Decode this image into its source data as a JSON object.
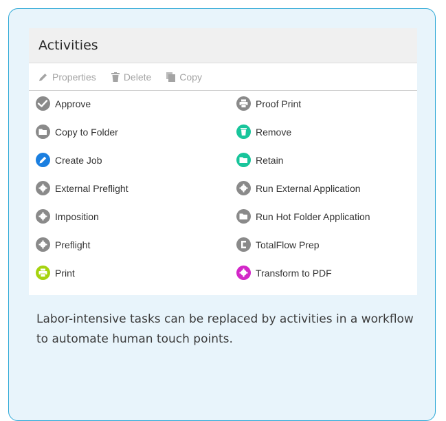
{
  "panel": {
    "title": "Activities",
    "toolbar": {
      "properties": "Properties",
      "delete": "Delete",
      "copy": "Copy"
    }
  },
  "activities": [
    {
      "label": "Approve",
      "icon": "check-icon",
      "color": "#8a8a8a"
    },
    {
      "label": "Copy to Folder",
      "icon": "folder-icon",
      "color": "#8a8a8a"
    },
    {
      "label": "Create Job",
      "icon": "pencil-icon",
      "color": "#1b7fe0"
    },
    {
      "label": "External Preflight",
      "icon": "gear-icon",
      "color": "#8a8a8a"
    },
    {
      "label": "Imposition",
      "icon": "gear-icon",
      "color": "#8a8a8a"
    },
    {
      "label": "Preflight",
      "icon": "gear-icon",
      "color": "#8a8a8a"
    },
    {
      "label": "Print",
      "icon": "printer-icon",
      "color": "#a6d30f"
    },
    {
      "label": "Proof Print",
      "icon": "printer-icon",
      "color": "#8a8a8a"
    },
    {
      "label": "Remove",
      "icon": "trash-icon",
      "color": "#18c59b"
    },
    {
      "label": "Retain",
      "icon": "folder-icon",
      "color": "#18c59b"
    },
    {
      "label": "Run External Application",
      "icon": "gear-icon",
      "color": "#8a8a8a"
    },
    {
      "label": "Run Hot Folder Application",
      "icon": "folder-icon",
      "color": "#8a8a8a"
    },
    {
      "label": "TotalFlow Prep",
      "icon": "prep-icon",
      "color": "#8a8a8a"
    },
    {
      "label": "Transform to PDF",
      "icon": "gear-icon",
      "color": "#d327c8"
    }
  ],
  "caption": "Labor-intensive tasks can be replaced by activities in a workflow to automate human touch points."
}
